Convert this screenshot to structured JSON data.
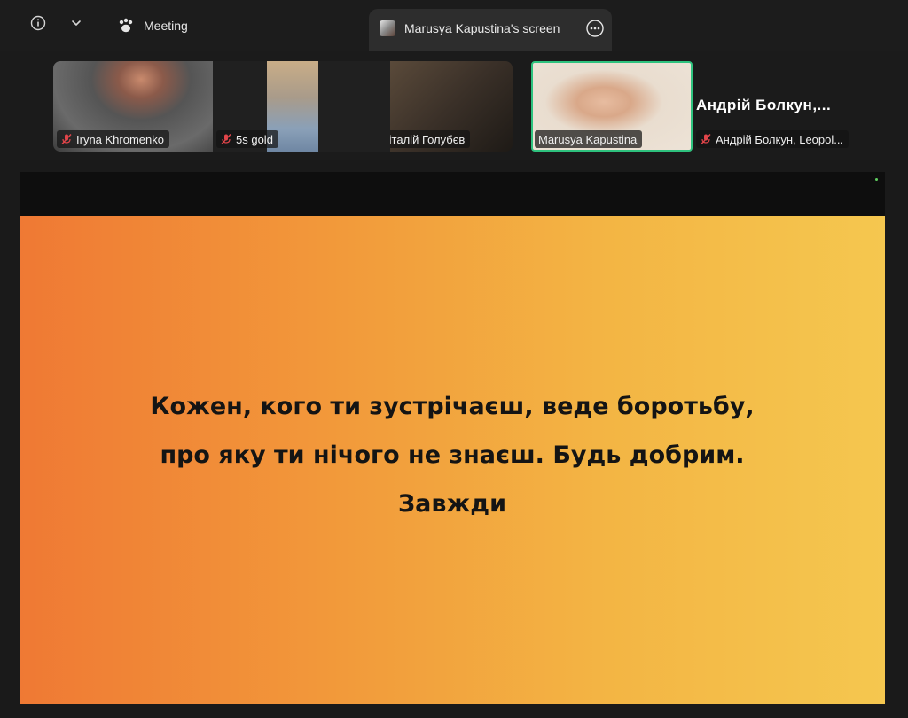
{
  "topbar": {
    "meeting_label": "Meeting",
    "share_tab_label": "Marusya Kapustina's screen"
  },
  "participants": [
    {
      "name": "Iryna Khromenko",
      "muted": true
    },
    {
      "name": "5s gold",
      "muted": true
    },
    {
      "name": "Віталій Голубєв",
      "muted": false
    },
    {
      "name": "Marusya Kapustina",
      "muted": false,
      "active_speaker": true
    },
    {
      "name": "Андрій Болкун, Leopol...",
      "title": "Андрій Болкун,...",
      "muted": true
    }
  ],
  "slide": {
    "lines": [
      "Кожен, кого ти зустрічаєш, веде боротьбу,",
      "про яку ти нічого не знаєш. Будь добрим.",
      "Завжди"
    ]
  },
  "colors": {
    "active_border": "#2ec27e",
    "slide_gradient_start": "#ef7934",
    "slide_gradient_end": "#f5c74f",
    "muted_icon": "#e2454a"
  },
  "icons": {
    "info": "info-icon",
    "dropdown": "chevron-down-icon",
    "meeting": "paw-icon",
    "more": "more-options-icon",
    "mic": "mic-muted-icon"
  }
}
